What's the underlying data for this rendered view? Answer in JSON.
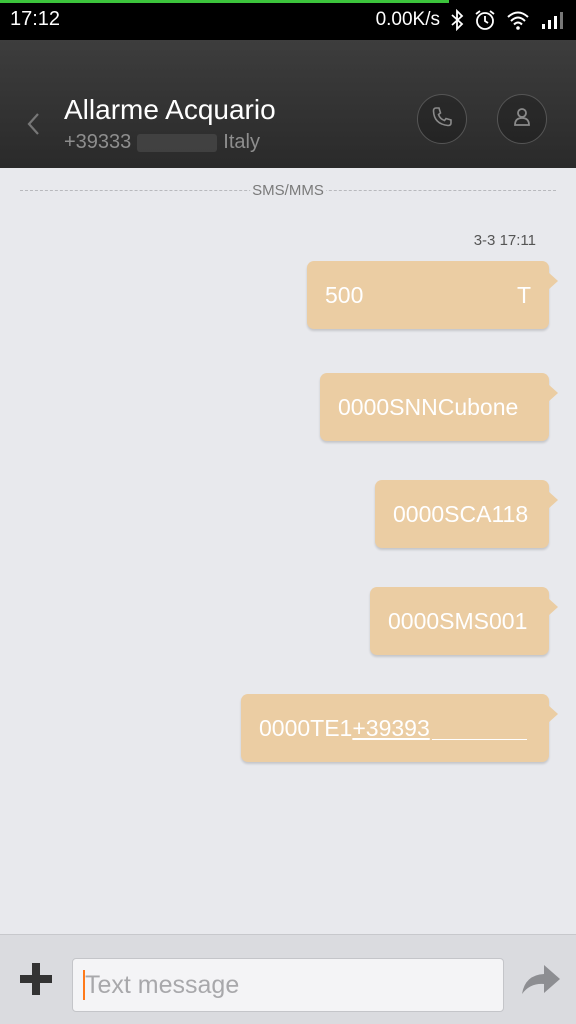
{
  "status_bar": {
    "time": "17:12",
    "net_speed": "0.00K/s",
    "download_progress": 0.78,
    "icons": [
      "bluetooth-icon",
      "alarm-icon",
      "wifi-icon",
      "signal-icon"
    ]
  },
  "header": {
    "title": "Allarme Acquario",
    "phone_prefix": "+39333",
    "country": "Italy"
  },
  "conversation": {
    "divider_label": "SMS/MMS",
    "timestamp": "3-3 17:11",
    "messages": [
      {
        "left": "500",
        "right": "T"
      },
      {
        "text": "0000SNNCubone"
      },
      {
        "text": "0000SCA118"
      },
      {
        "text": "0000SMS001"
      },
      {
        "prefix": "0000TE1",
        "link": "+39393"
      }
    ]
  },
  "compose": {
    "placeholder": "Text message"
  },
  "colors": {
    "bubble": "#ebcda3",
    "header": "#2f2f2f",
    "background": "#e8e9ed",
    "caret": "#ff7a1a",
    "progress": "#3cc43c"
  }
}
